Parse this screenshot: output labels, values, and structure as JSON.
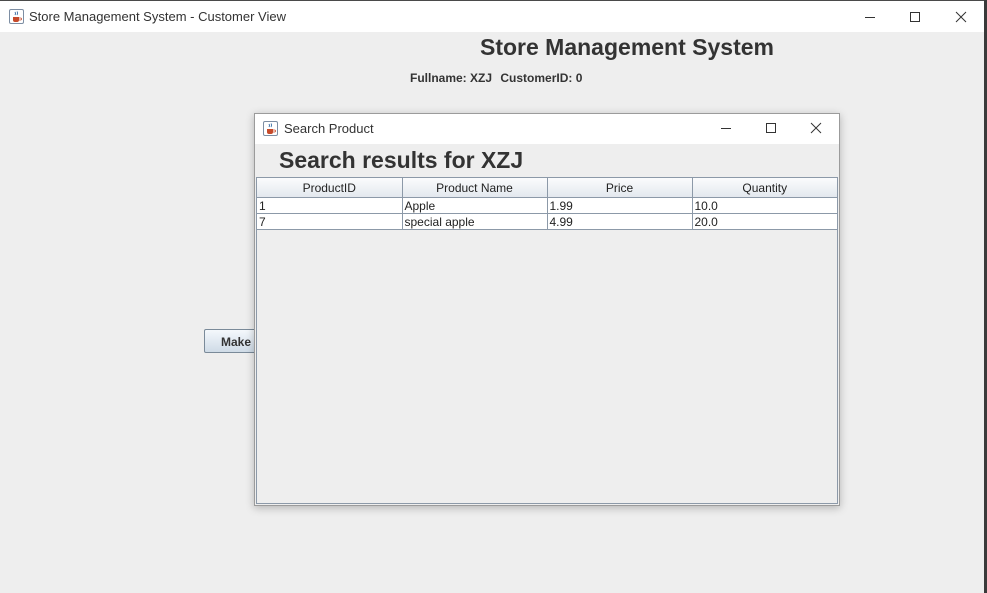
{
  "window": {
    "title": "Store Management System - Customer View",
    "icon": "java-cup-icon"
  },
  "header": {
    "title": "Store Management System",
    "fullname_label": "Fullname: XZJ",
    "customer_label": "CustomerID: 0"
  },
  "make_button": {
    "label": "Make"
  },
  "dialog": {
    "title": "Search Product",
    "heading": "Search results for XZJ",
    "table": {
      "columns": [
        "ProductID",
        "Product Name",
        "Price",
        "Quantity"
      ],
      "rows": [
        [
          "1",
          "Apple",
          "1.99",
          "10.0"
        ],
        [
          "7",
          "special apple",
          "4.99",
          "20.0"
        ]
      ]
    }
  }
}
